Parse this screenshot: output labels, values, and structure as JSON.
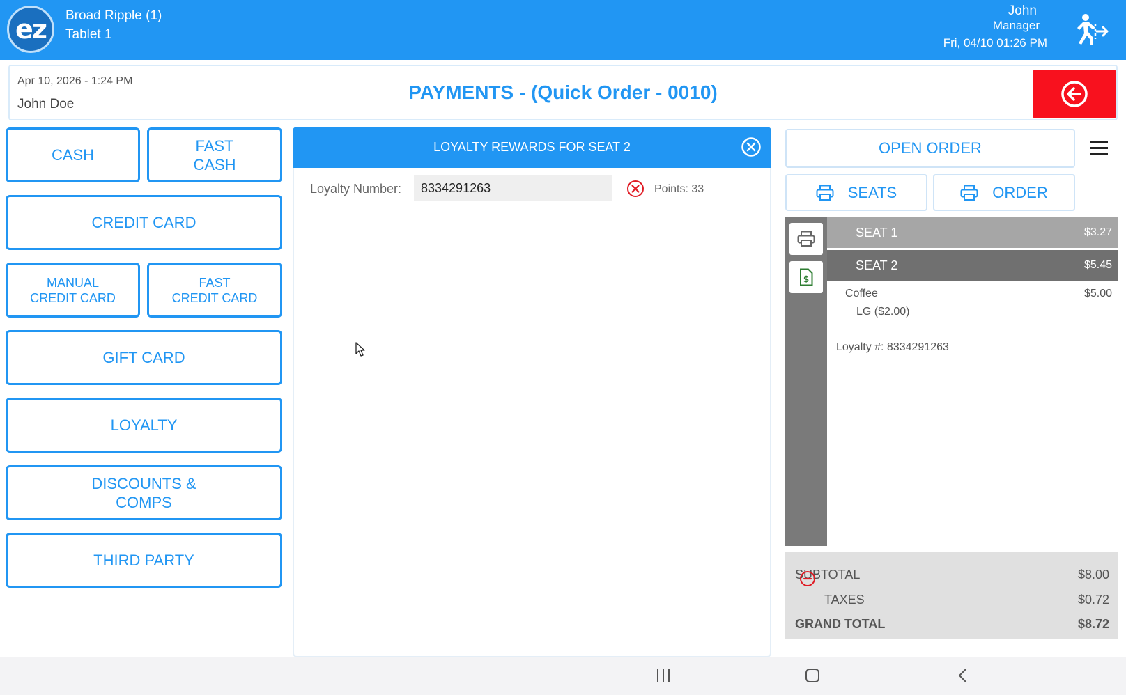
{
  "topbar": {
    "logo_text": "ez",
    "store_name": "Broad Ripple (1)",
    "tablet_name": "Tablet 1",
    "user_name": "John",
    "user_role": "Manager",
    "datetime": "Fri, 04/10 01:26 PM",
    "logout_icon": "logout-running-icon"
  },
  "header": {
    "order_date": "Apr 10, 2026  - 1:24 PM",
    "customer_name": "John Doe",
    "title": "PAYMENTS - (Quick Order - 0010)",
    "back_icon": "arrow-left-circle-icon"
  },
  "payment_methods": {
    "cash": "CASH",
    "fast_cash": "FAST\nCASH",
    "credit_card": "CREDIT CARD",
    "manual_credit_card": "MANUAL\nCREDIT CARD",
    "fast_credit_card": "FAST\nCREDIT CARD",
    "gift_card": "GIFT CARD",
    "loyalty": "LOYALTY",
    "discounts_comps": "DISCOUNTS &\nCOMPS",
    "third_party": "THIRD PARTY"
  },
  "loyalty_panel": {
    "title": "LOYALTY REWARDS FOR SEAT 2",
    "number_label": "Loyalty Number:",
    "number_value": "8334291263",
    "points": "Points: 33"
  },
  "actions": {
    "open_order": "OPEN ORDER",
    "print_seats": "SEATS",
    "print_order": "ORDER"
  },
  "receipt": {
    "seats": [
      {
        "label": "SEAT 1",
        "amount": "$3.27"
      },
      {
        "label": "SEAT 2",
        "amount": "$5.45"
      }
    ],
    "items": [
      {
        "name": "Coffee",
        "price": "$5.00",
        "modifier": "LG  ($2.00)"
      }
    ],
    "loyalty_line": "Loyalty #:  8334291263"
  },
  "totals": {
    "subtotal_label": "SUBTOTAL",
    "subtotal_value": "$8.00",
    "taxes_label": "TAXES",
    "taxes_value": "$0.72",
    "grand_total_label": "GRAND TOTAL",
    "grand_total_value": "$8.72"
  },
  "colors": {
    "primary": "#2196f3",
    "danger": "#f8111e",
    "seat_selected": "#707070",
    "seat_unselected": "#a6a6a6"
  }
}
